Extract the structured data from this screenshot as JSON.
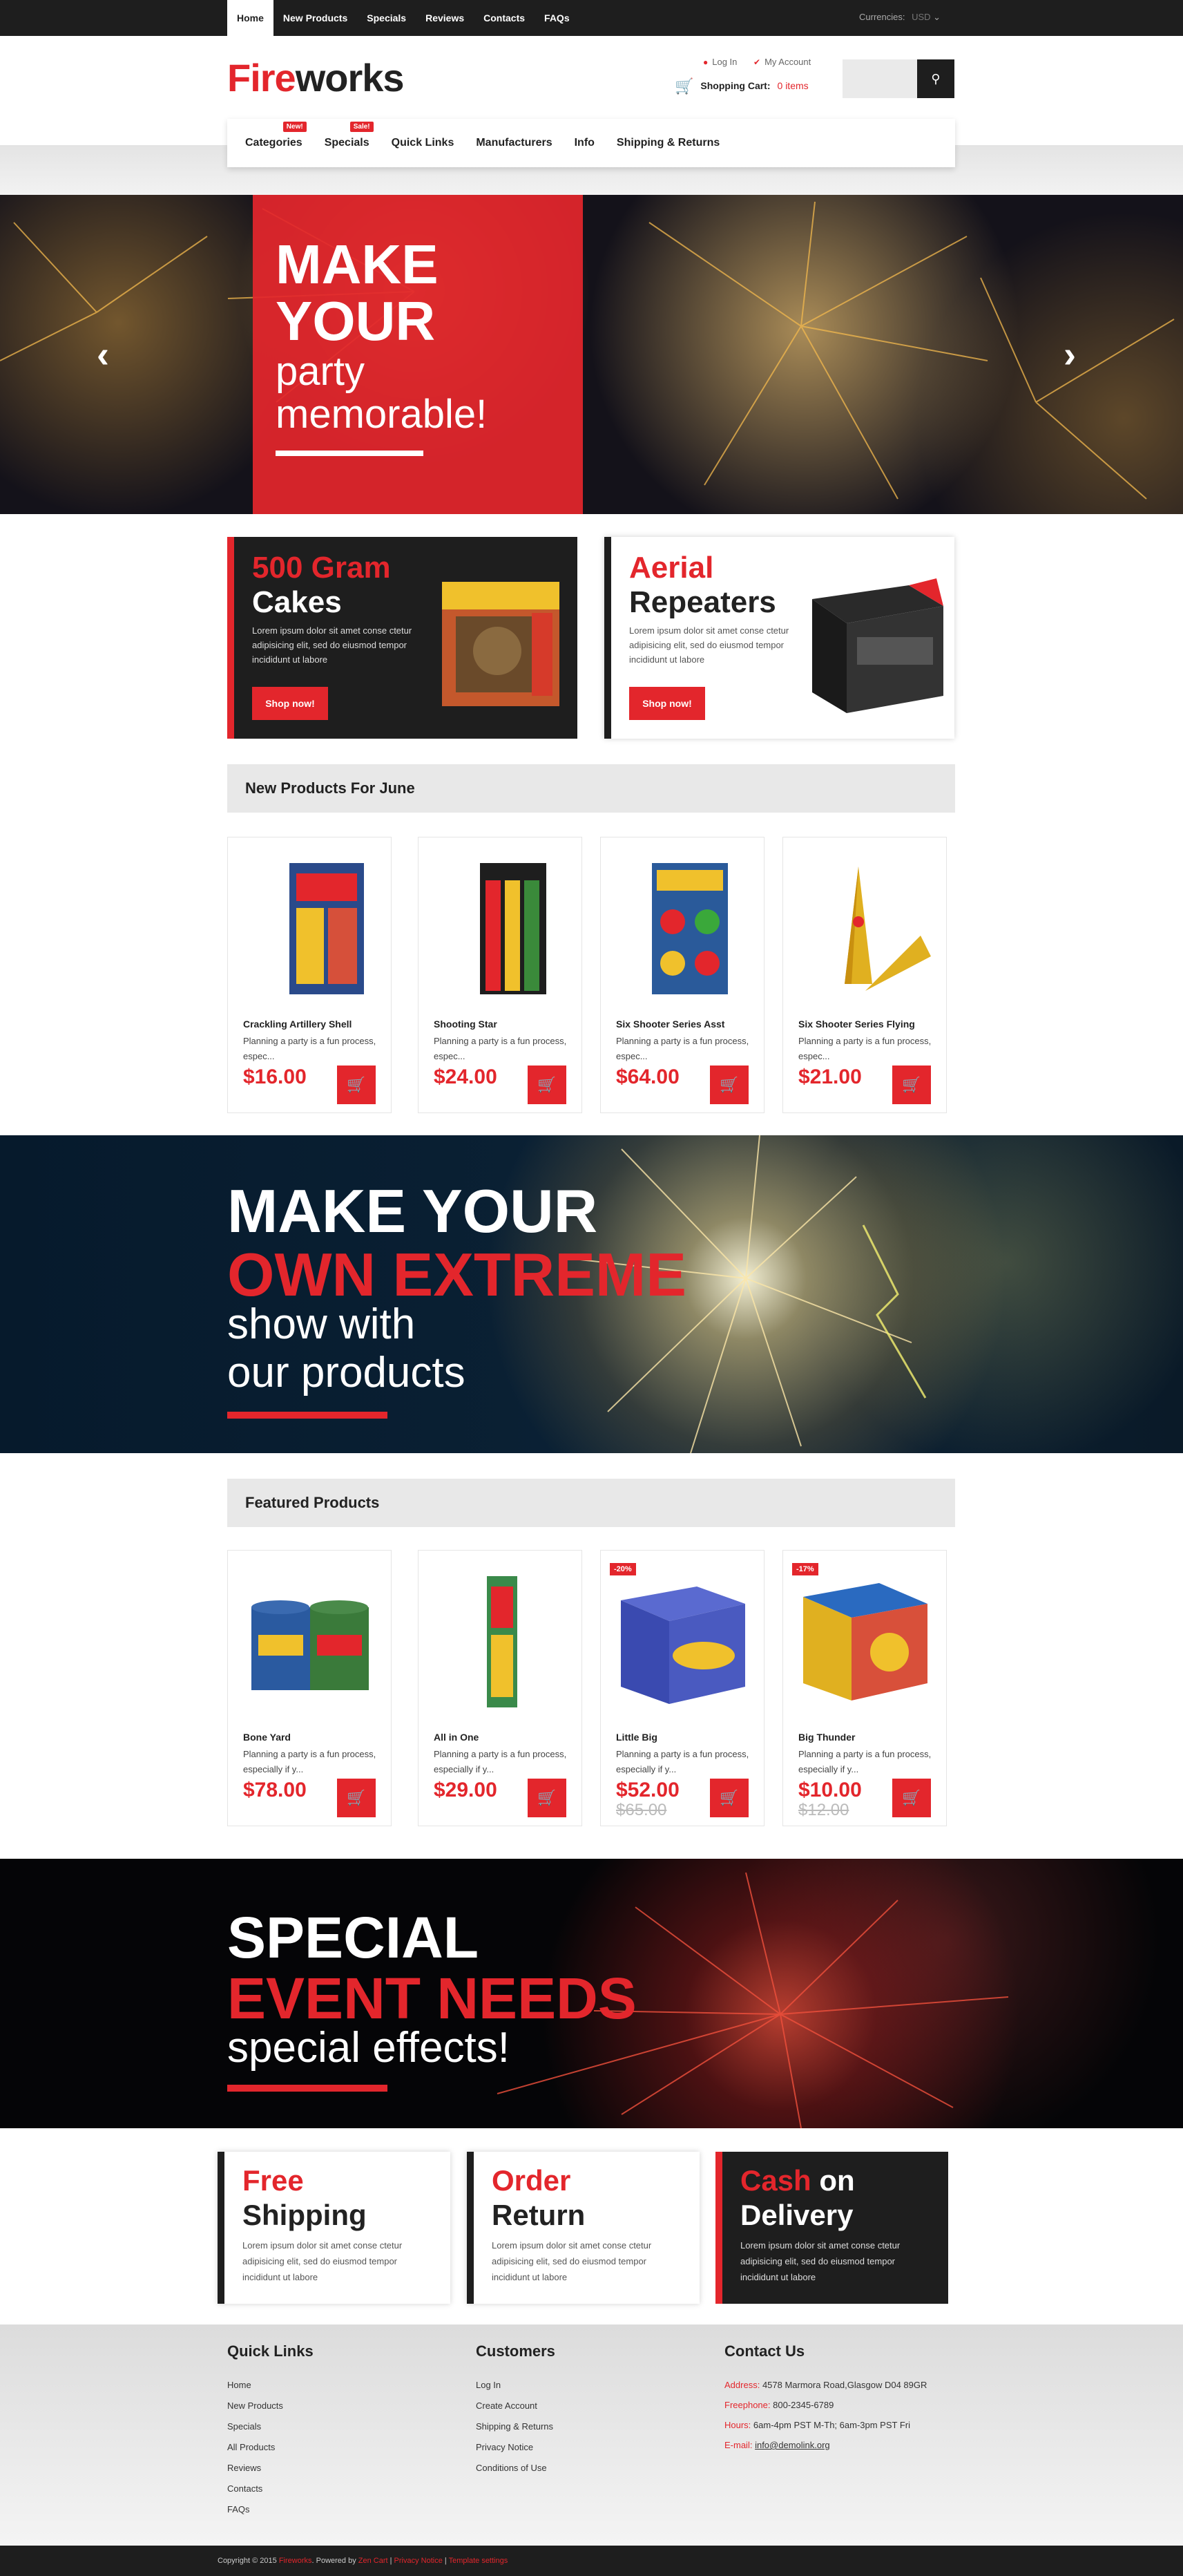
{
  "topbar": {
    "nav": [
      "Home",
      "New Products",
      "Specials",
      "Reviews",
      "Contacts",
      "FAQs"
    ],
    "currency_label": "Currencies:",
    "currency_value": "USD"
  },
  "header": {
    "logo_part1": "Fire",
    "logo_part2": "works",
    "login": "Log In",
    "my_account": "My Account",
    "cart_label": "Shopping Cart:",
    "cart_count": "0 items"
  },
  "mainnav": {
    "items": [
      "Categories",
      "Specials",
      "Quick Links",
      "Manufacturers",
      "Info",
      "Shipping & Returns"
    ],
    "badge_new": "New!",
    "badge_sale": "Sale!"
  },
  "hero": {
    "line1": "MAKE",
    "line2": "YOUR",
    "line3": "party",
    "line4": "memorable!"
  },
  "promos": [
    {
      "title1": "500 Gram",
      "title2": "Cakes",
      "text": "Lorem ipsum dolor sit amet conse ctetur adipisicing elit, sed do eiusmod tempor incididunt ut labore",
      "button": "Shop now!"
    },
    {
      "title1": "Aerial",
      "title2": "Repeaters",
      "text": "Lorem ipsum dolor sit amet conse ctetur adipisicing elit, sed do eiusmod tempor incididunt ut labore",
      "button": "Shop now!"
    }
  ],
  "new_products": {
    "title": "New Products For June",
    "items": [
      {
        "name": "Crackling Artillery Shell",
        "desc": "Planning a party is a fun process, espec...",
        "price": "$16.00"
      },
      {
        "name": "Shooting Star",
        "desc": "Planning a party is a fun process, espec...",
        "price": "$24.00"
      },
      {
        "name": "Six Shooter Series Asst",
        "desc": "Planning a party is a fun process, espec...",
        "price": "$64.00"
      },
      {
        "name": "Six Shooter Series Flying",
        "desc": "Planning a party is a fun process, espec...",
        "price": "$21.00"
      }
    ]
  },
  "banner1": {
    "line1": "MAKE YOUR",
    "line2": "OWN EXTREME",
    "line3": "show with",
    "line4": "our products"
  },
  "featured": {
    "title": "Featured Products",
    "items": [
      {
        "name": "Bone Yard",
        "desc": "Planning a party is a fun process, especially if y...",
        "price": "$78.00",
        "old": "",
        "sale": ""
      },
      {
        "name": "All in One",
        "desc": "Planning a party is a fun process, especially if y...",
        "price": "$29.00",
        "old": "",
        "sale": ""
      },
      {
        "name": "Little Big",
        "desc": "Planning a party is a fun process, especially if y...",
        "price": "$52.00",
        "old": "$65.00",
        "sale": "-20%"
      },
      {
        "name": "Big Thunder",
        "desc": "Planning a party is a fun process, especially if y...",
        "price": "$10.00",
        "old": "$12.00",
        "sale": "-17%"
      }
    ]
  },
  "banner2": {
    "line1": "SPECIAL",
    "line2": "EVENT NEEDS",
    "line3": "special effects!"
  },
  "features": [
    {
      "t1": "Free",
      "t1b": "",
      "t2": "Shipping",
      "text": "Lorem ipsum dolor sit amet conse ctetur adipisicing elit, sed do eiusmod tempor incididunt ut labore"
    },
    {
      "t1": "Order",
      "t1b": "",
      "t2": "Return",
      "text": "Lorem ipsum dolor sit amet conse ctetur adipisicing elit, sed do eiusmod tempor incididunt ut labore"
    },
    {
      "t1": "Cash",
      "t1b": " on",
      "t2": "Delivery",
      "text": "Lorem ipsum dolor sit amet conse ctetur adipisicing elit, sed do eiusmod tempor incididunt ut labore"
    }
  ],
  "footer": {
    "quick_links_title": "Quick Links",
    "quick_links": [
      "Home",
      "New Products",
      "Specials",
      "All Products",
      "Reviews",
      "Contacts",
      "FAQs"
    ],
    "customers_title": "Customers",
    "customers": [
      "Log In",
      "Create Account",
      "Shipping & Returns",
      "Privacy Notice",
      "Conditions of Use"
    ],
    "contact_title": "Contact Us",
    "contact": [
      {
        "k": "Address:",
        "v": "4578 Marmora Road,Glasgow D04 89GR"
      },
      {
        "k": "Freephone:",
        "v": "800-2345-6789"
      },
      {
        "k": "Hours:",
        "v": "6am-4pm PST M-Th; 6am-3pm PST Fri"
      },
      {
        "k": "E-mail:",
        "v": "info@demolink.org"
      }
    ]
  },
  "copyright": {
    "prefix": "Copyright © 2015",
    "site": "Fireworks",
    "powered": ". Powered by",
    "zen": "Zen Cart",
    "sep1": "|",
    "privacy": "Privacy Notice",
    "sep2": "|",
    "template": "Template settings"
  },
  "colors": {
    "accent": "#e3262c",
    "dark": "#1e1e1e"
  }
}
